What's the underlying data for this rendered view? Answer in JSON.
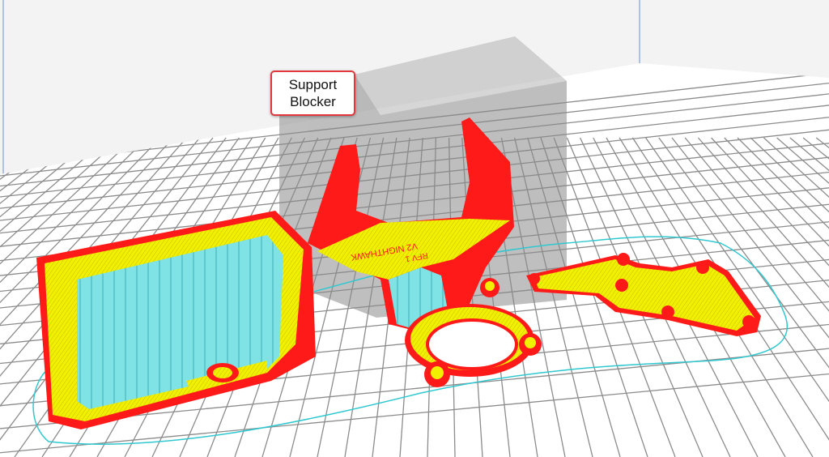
{
  "callout": {
    "line1": "Support",
    "line2": "Blocker"
  },
  "part_engraving": {
    "line1": "V2 NIGHTHAWK",
    "line2": "RFV 1"
  },
  "colors": {
    "background": "#f3f3f3",
    "grid_plate": "#ffffff",
    "grid_lines": "#8c8c8c",
    "wall_red": "#ff1a1a",
    "infill_yellow": "#f0f000",
    "inner_wall_cyan": "#7fe3e6",
    "support_blocker": "#9c9c9c",
    "skirt_outline": "#30c8d0",
    "callout_border": "#e0383c"
  }
}
